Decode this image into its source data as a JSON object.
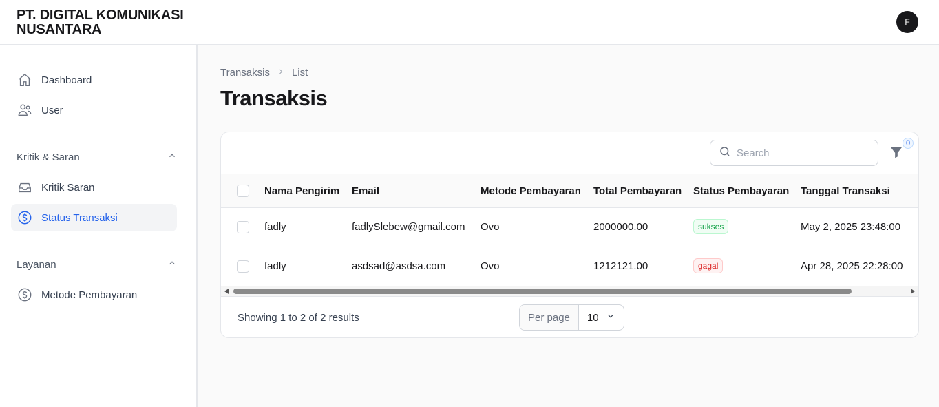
{
  "app": {
    "brand": "PT. DIGITAL KOMUNIKASI NUSANTARA",
    "avatar_initial": "F"
  },
  "sidebar": {
    "items": [
      {
        "label": "Dashboard",
        "icon": "home-icon"
      },
      {
        "label": "User",
        "icon": "users-icon"
      }
    ],
    "groups": [
      {
        "label": "Kritik & Saran",
        "items": [
          {
            "label": "Kritik Saran",
            "icon": "inbox-icon"
          },
          {
            "label": "Status Transaksi",
            "icon": "dollar-circle-icon",
            "active": true
          }
        ]
      },
      {
        "label": "Layanan",
        "items": [
          {
            "label": "Metode Pembayaran",
            "icon": "dollar-circle-icon"
          }
        ]
      }
    ]
  },
  "breadcrumb": [
    "Transaksis",
    "List"
  ],
  "page_title": "Transaksis",
  "toolbar": {
    "search_placeholder": "Search",
    "filter_count": "0"
  },
  "table": {
    "columns": [
      "Nama Pengirim",
      "Email",
      "Metode Pembayaran",
      "Total Pembayaran",
      "Status Pembayaran",
      "Tanggal Transaksi"
    ],
    "rows": [
      {
        "nama": "fadly",
        "email": "fadlySlebew@gmail.com",
        "metode": "Ovo",
        "total": "2000000.00",
        "status": "sukses",
        "tanggal": "May 2, 2025 23:48:00"
      },
      {
        "nama": "fadly",
        "email": "asdsad@asdsa.com",
        "metode": "Ovo",
        "total": "1212121.00",
        "status": "gagal",
        "tanggal": "Apr 28, 2025 22:28:00"
      }
    ]
  },
  "pagination": {
    "showing": "Showing 1 to 2 of 2 results",
    "per_page_label": "Per page",
    "per_page_value": "10"
  },
  "colors": {
    "accent": "#2563eb",
    "success": "#16a34a",
    "danger": "#dc2626"
  }
}
